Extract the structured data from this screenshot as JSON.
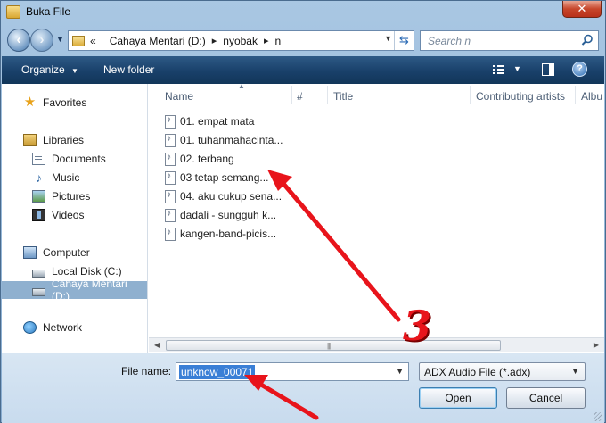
{
  "window": {
    "title": "Buka File",
    "close_label": "✕"
  },
  "address": {
    "overflow": "«",
    "crumbs": [
      "Cahaya Mentari (D:)",
      "nyobak",
      "n"
    ],
    "search_placeholder": "Search n"
  },
  "toolbar": {
    "organize": "Organize",
    "new_folder": "New folder",
    "help": "?"
  },
  "sidebar": {
    "favorites": "Favorites",
    "libraries": "Libraries",
    "documents": "Documents",
    "music": "Music",
    "pictures": "Pictures",
    "videos": "Videos",
    "computer": "Computer",
    "local_disk": "Local Disk (C:)",
    "cahaya_mentari": "Cahaya Mentari (D:)",
    "network": "Network"
  },
  "columns": {
    "name": "Name",
    "num": "#",
    "title": "Title",
    "artists": "Contributing artists",
    "album": "Albu"
  },
  "files": [
    "01. empat mata",
    "01. tuhanmahacinta...",
    "02. terbang",
    "03 tetap semang...",
    "04. aku cukup sena...",
    "dadali - sungguh k...",
    "kangen-band-picis..."
  ],
  "bottom": {
    "filename_label": "File name:",
    "filename_value": "unknow_00071",
    "filetype": "ADX Audio File (*.adx)",
    "open": "Open",
    "cancel": "Cancel"
  },
  "annotation": {
    "number": "3",
    "color": "#e8141b"
  }
}
